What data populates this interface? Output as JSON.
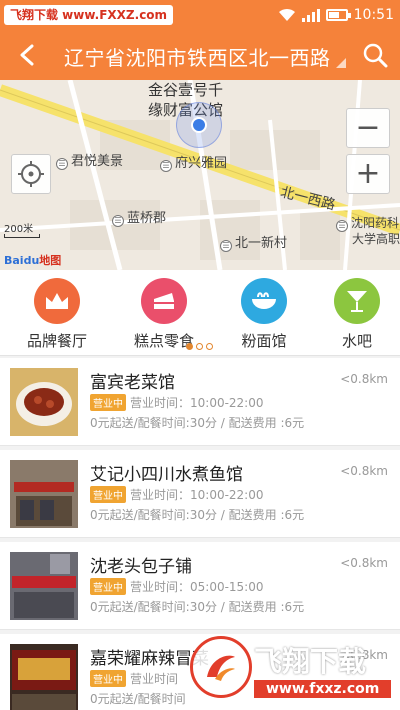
{
  "status_bar": {
    "watermark_text": "飞翔下载 www.FXXZ.com",
    "time": "10:51"
  },
  "header": {
    "title": "辽宁省沈阳市铁西区北一西路",
    "back_icon": "back-arrow-icon",
    "search_icon": "search-icon"
  },
  "map": {
    "place_name_line1": "金谷壹号千",
    "place_name_line2": "缘财富公馆",
    "labels": [
      "君悦美景",
      "府兴雅园",
      "蓝桥郡",
      "北一新村"
    ],
    "label_poi_right": "沈阳药科",
    "label_poi_right2": "大学高职",
    "road": "北一西路",
    "scale": "200米",
    "provider": "Baidu",
    "provider_cn": "地图",
    "zoom_in": "+",
    "zoom_out": "−"
  },
  "categories": [
    {
      "label": "品牌餐厅",
      "color": "#f06a3c",
      "icon": "crown-icon"
    },
    {
      "label": "糕点零食",
      "color": "#ea4f6b",
      "icon": "cake-icon"
    },
    {
      "label": "粉面馆",
      "color": "#2ea9e0",
      "icon": "noodle-bowl-icon"
    },
    {
      "label": "水吧",
      "color": "#8cc63f",
      "icon": "cocktail-icon"
    }
  ],
  "shops": [
    {
      "name": "富宾老菜馆",
      "distance": "<0.8km",
      "status": "营业中",
      "hours": "营业时间：10:00-22:00",
      "delivery": "0元起送/配餐时间:30分 / 配送费用 :6元"
    },
    {
      "name": "艾记小四川水煮鱼馆",
      "distance": "<0.8km",
      "status": "营业中",
      "hours": "营业时间：10:00-22:00",
      "delivery": "0元起送/配餐时间:30分 / 配送费用 :6元"
    },
    {
      "name": "沈老头包子铺",
      "distance": "<0.8km",
      "status": "营业中",
      "hours": "营业时间：05:00-15:00",
      "delivery": "0元起送/配餐时间:30分 / 配送费用 :6元"
    },
    {
      "name": "嘉荣耀麻辣冒菜",
      "distance": "<0.8km",
      "status": "营业中",
      "hours": "营业时间",
      "delivery": "0元起送/配餐时间"
    }
  ],
  "watermark": {
    "brand": "飞翔下载",
    "url": "www.fxxz.com"
  }
}
